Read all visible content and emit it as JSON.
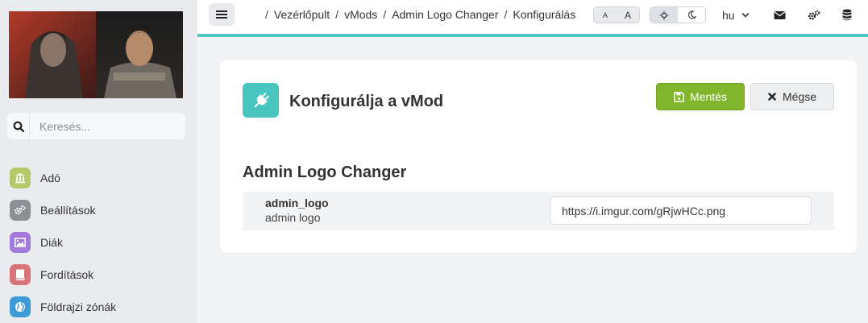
{
  "sidebar": {
    "logo_alt": "logo",
    "search": {
      "placeholder": "Keresés..."
    },
    "items": [
      {
        "label": "Adó",
        "icon": "bank-icon",
        "color": "#b5c86a"
      },
      {
        "label": "Beállítások",
        "icon": "gears-icon",
        "color": "#8c8f94"
      },
      {
        "label": "Diák",
        "icon": "image-icon",
        "color": "#a37ad9"
      },
      {
        "label": "Fordítások",
        "icon": "book-icon",
        "color": "#d9737a"
      },
      {
        "label": "Földrajzi zónák",
        "icon": "globe-icon",
        "color": "#3e9bd8"
      }
    ]
  },
  "topbar": {
    "breadcrumb": [
      "Vezérlőpult",
      "vMods",
      "Admin Logo Changer",
      "Konfigurálás"
    ],
    "breadcrumb_sep": "/",
    "font_small": "A",
    "font_large": "A",
    "language": "hu",
    "accent_color": "#4cc7c2"
  },
  "main": {
    "title": "Konfigurálja a vMod",
    "save_label": "Mentés",
    "cancel_label": "Mégse",
    "section_title": "Admin Logo Changer",
    "settings": [
      {
        "key": "admin_logo",
        "description": "admin logo",
        "value": "https://i.imgur.com/gRjwHCc.png"
      }
    ],
    "save_color": "#80b52c",
    "icon_color": "#49c5bf"
  }
}
